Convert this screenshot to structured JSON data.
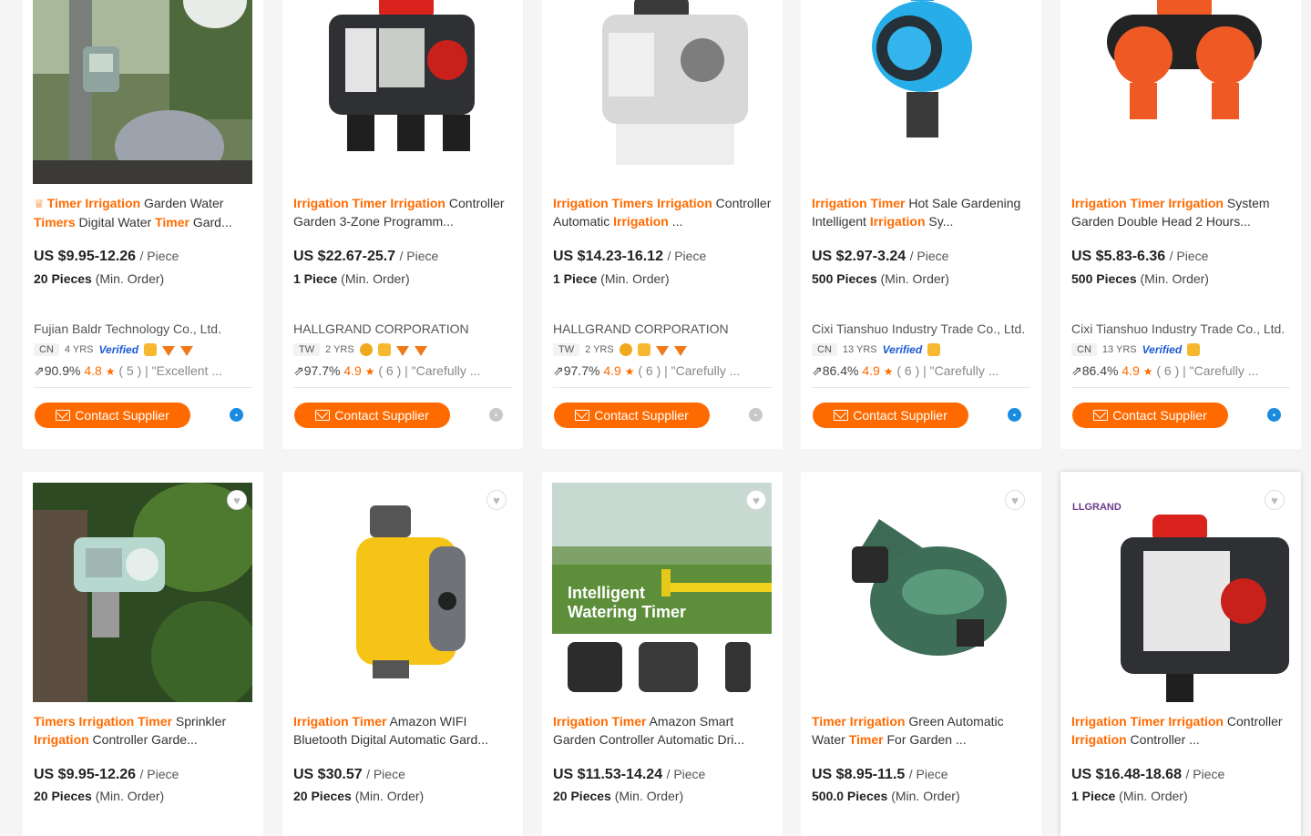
{
  "products": [
    {
      "title_parts": [
        {
          "t": "Timer Irrigation",
          "kw": true
        },
        {
          "t": " Garden Water ",
          "kw": false
        },
        {
          "t": "Timers",
          "kw": true
        },
        {
          "t": " Digital Water ",
          "kw": false
        },
        {
          "t": "Timer",
          "kw": true
        },
        {
          "t": " Gard...",
          "kw": false
        }
      ],
      "crown": true,
      "price": "US $9.95-12.26",
      "unit": "/ Piece",
      "moq_qty": "20 Pieces",
      "moq_label": "(Min. Order)",
      "supplier": "Fujian Baldr Technology Co., Ltd.",
      "country": "CN",
      "years": "4 YRS",
      "verified": "Verified",
      "response_rate": "90.9%",
      "rating": "4.8",
      "reviews": "( 5 )",
      "review_text": "| \"Excellent ...",
      "contact": "Contact Supplier",
      "chat_online": true,
      "badges": [
        "medal",
        "diamond",
        "diamond"
      ]
    },
    {
      "title_parts": [
        {
          "t": "Irrigation Timer Irrigation",
          "kw": true
        },
        {
          "t": " Controller Garden 3-Zone Programm...",
          "kw": false
        }
      ],
      "crown": false,
      "price": "US $22.67-25.7",
      "unit": "/ Piece",
      "moq_qty": "1 Piece",
      "moq_label": "(Min. Order)",
      "supplier": "HALLGRAND CORPORATION",
      "country": "TW",
      "years": "2 YRS",
      "verified": "",
      "response_rate": "97.7%",
      "rating": "4.9",
      "reviews": "( 6 )",
      "review_text": "| \"Carefully ...",
      "contact": "Contact Supplier",
      "chat_online": false,
      "badges": [
        "coin",
        "medal",
        "diamond",
        "diamond"
      ]
    },
    {
      "title_parts": [
        {
          "t": "Irrigation Timers Irrigation",
          "kw": true
        },
        {
          "t": " Controller Automatic ",
          "kw": false
        },
        {
          "t": "Irrigation",
          "kw": true
        },
        {
          "t": " ...",
          "kw": false
        }
      ],
      "crown": false,
      "price": "US $14.23-16.12",
      "unit": "/ Piece",
      "moq_qty": "1 Piece",
      "moq_label": "(Min. Order)",
      "supplier": "HALLGRAND CORPORATION",
      "country": "TW",
      "years": "2 YRS",
      "verified": "",
      "response_rate": "97.7%",
      "rating": "4.9",
      "reviews": "( 6 )",
      "review_text": "| \"Carefully ...",
      "contact": "Contact Supplier",
      "chat_online": false,
      "badges": [
        "coin",
        "medal",
        "diamond",
        "diamond"
      ]
    },
    {
      "title_parts": [
        {
          "t": "Irrigation Timer",
          "kw": true
        },
        {
          "t": " Hot Sale Gardening Intelligent ",
          "kw": false
        },
        {
          "t": "Irrigation",
          "kw": true
        },
        {
          "t": " Sy...",
          "kw": false
        }
      ],
      "crown": false,
      "price": "US $2.97-3.24",
      "unit": "/ Piece",
      "moq_qty": "500 Pieces",
      "moq_label": "(Min. Order)",
      "supplier": "Cixi Tianshuo Industry Trade Co., Ltd.",
      "country": "CN",
      "years": "13 YRS",
      "verified": "Verified",
      "response_rate": "86.4%",
      "rating": "4.9",
      "reviews": "( 6 )",
      "review_text": "| \"Carefully ...",
      "contact": "Contact Supplier",
      "chat_online": true,
      "badges": [
        "medal"
      ]
    },
    {
      "title_parts": [
        {
          "t": "Irrigation Timer Irrigation",
          "kw": true
        },
        {
          "t": " System Garden Double Head 2 Hours...",
          "kw": false
        }
      ],
      "crown": false,
      "price": "US $5.83-6.36",
      "unit": "/ Piece",
      "moq_qty": "500 Pieces",
      "moq_label": "(Min. Order)",
      "supplier": "Cixi Tianshuo Industry Trade Co., Ltd.",
      "country": "CN",
      "years": "13 YRS",
      "verified": "Verified",
      "response_rate": "86.4%",
      "rating": "4.9",
      "reviews": "( 6 )",
      "review_text": "| \"Carefully ...",
      "contact": "Contact Supplier",
      "chat_online": true,
      "badges": [
        "medal"
      ]
    },
    {
      "title_parts": [
        {
          "t": "Timers Irrigation Timer",
          "kw": true
        },
        {
          "t": " Sprinkler ",
          "kw": false
        },
        {
          "t": "Irrigation",
          "kw": true
        },
        {
          "t": " Controller Garde...",
          "kw": false
        }
      ],
      "price": "US $9.95-12.26",
      "unit": "/ Piece",
      "moq_qty": "20 Pieces",
      "moq_label": "(Min. Order)"
    },
    {
      "title_parts": [
        {
          "t": "Irrigation Timer",
          "kw": true
        },
        {
          "t": " Amazon WIFI Bluetooth Digital Automatic Gard...",
          "kw": false
        }
      ],
      "price": "US $30.57",
      "unit": "/ Piece",
      "moq_qty": "20 Pieces",
      "moq_label": "(Min. Order)"
    },
    {
      "title_parts": [
        {
          "t": "Irrigation Timer",
          "kw": true
        },
        {
          "t": " Amazon Smart Garden Controller Automatic Dri...",
          "kw": false
        }
      ],
      "price": "US $11.53-14.24",
      "unit": "/ Piece",
      "moq_qty": "20 Pieces",
      "moq_label": "(Min. Order)",
      "image_text": [
        "Intelligent",
        "Watering Timer"
      ]
    },
    {
      "title_parts": [
        {
          "t": "Timer Irrigation",
          "kw": true
        },
        {
          "t": " Green Automatic Water ",
          "kw": false
        },
        {
          "t": "Timer",
          "kw": true
        },
        {
          "t": " For Garden ...",
          "kw": false
        }
      ],
      "price": "US $8.95-11.5",
      "unit": "/ Piece",
      "moq_qty": "500.0 Pieces",
      "moq_label": "(Min. Order)"
    },
    {
      "title_parts": [
        {
          "t": "Irrigation Timer Irrigation",
          "kw": true
        },
        {
          "t": " Controller ",
          "kw": false
        },
        {
          "t": "Irrigation",
          "kw": true
        },
        {
          "t": " Controller ...",
          "kw": false
        }
      ],
      "price": "US $16.48-18.68",
      "unit": "/ Piece",
      "moq_qty": "1 Piece",
      "moq_label": "(Min. Order)",
      "logo_text": "LLGRAND"
    }
  ],
  "colors": {
    "accent": "#ff6a00",
    "background": "#f5f5f5",
    "verified": "#1a5ad6",
    "chat": "#1a8ce0"
  }
}
